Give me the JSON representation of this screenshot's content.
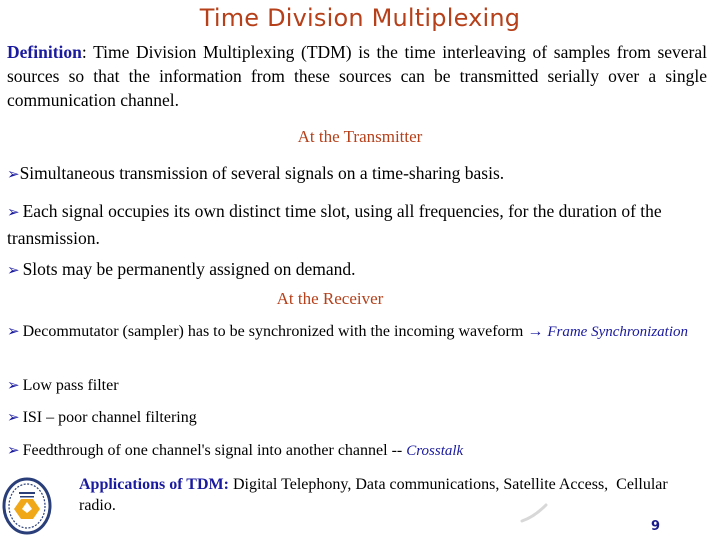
{
  "slide": {
    "title": "Time Division Multiplexing",
    "definition": {
      "label": "Definition",
      "separator": ": ",
      "text": "Time Division Multiplexing (TDM) is the time interleaving of samples from several sources so that the information from these sources can be transmitted serially over a single communication channel."
    },
    "transmitter": {
      "heading": "At the Transmitter",
      "bullets": [
        "Simultaneous transmission of several signals on a time-sharing basis.",
        "Each signal occupies its own distinct time slot, using all frequencies, for the duration of the transmission.",
        "Slots may be permanently assigned on demand."
      ]
    },
    "receiver": {
      "heading": "At the Receiver",
      "bullets": [
        {
          "text": "Decommutator (sampler) has to be synchronized  with the incoming waveform ",
          "arrow": "→",
          "emphasis": "Frame Synchronization"
        },
        {
          "text": "Low pass filter"
        },
        {
          "text": "ISI – poor channel filtering"
        },
        {
          "text": "Feedthrough of one channel's signal into another channel -- ",
          "emphasis": "Crosstalk"
        }
      ]
    },
    "applications": {
      "label": "Applications of TDM:",
      "text": " Digital Telephony,  Data communications,  Satellite Access,  Cellular radio."
    },
    "bullet_glyph": "➢",
    "page_number": "9",
    "icons": {
      "logo": "university-seal-logo",
      "bullet": "arrowhead-bullet-icon"
    },
    "colors": {
      "title": "#b5401a",
      "heading": "#b5401a",
      "accent_blue": "#1a1a9e"
    }
  }
}
